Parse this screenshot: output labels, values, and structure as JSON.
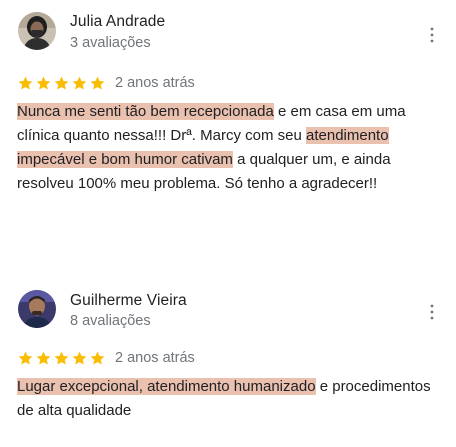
{
  "reviews": [
    {
      "author": "Julia Andrade",
      "review_count": "3 avaliações",
      "avatar_icon": "user-photo-woman-icon",
      "rating": 5,
      "date": "2 anos atrás",
      "menu_icon": "more-vertical-icon",
      "text_parts": [
        "Nunca me senti tão bem recepcionada",
        " e em casa em uma clínica quanto nessa!!! Drª. Marcy com seu ",
        "atendimento impecável e bom humor cativam",
        " a qualquer um, e ainda resolveu 100% meu problema. Só tenho a agradecer!!"
      ]
    },
    {
      "author": "Guilherme Vieira",
      "review_count": "8 avaliações",
      "avatar_icon": "user-photo-man-icon",
      "rating": 5,
      "date": "2 anos atrás",
      "menu_icon": "more-vertical-icon",
      "text_parts": [
        "Lugar excepcional, atendimento humanizado",
        " e procedimentos de alta qualidade"
      ]
    }
  ],
  "colors": {
    "star": "#fbbc04",
    "highlight": "#eac0af",
    "name": "#202124",
    "secondary": "#70757a"
  }
}
